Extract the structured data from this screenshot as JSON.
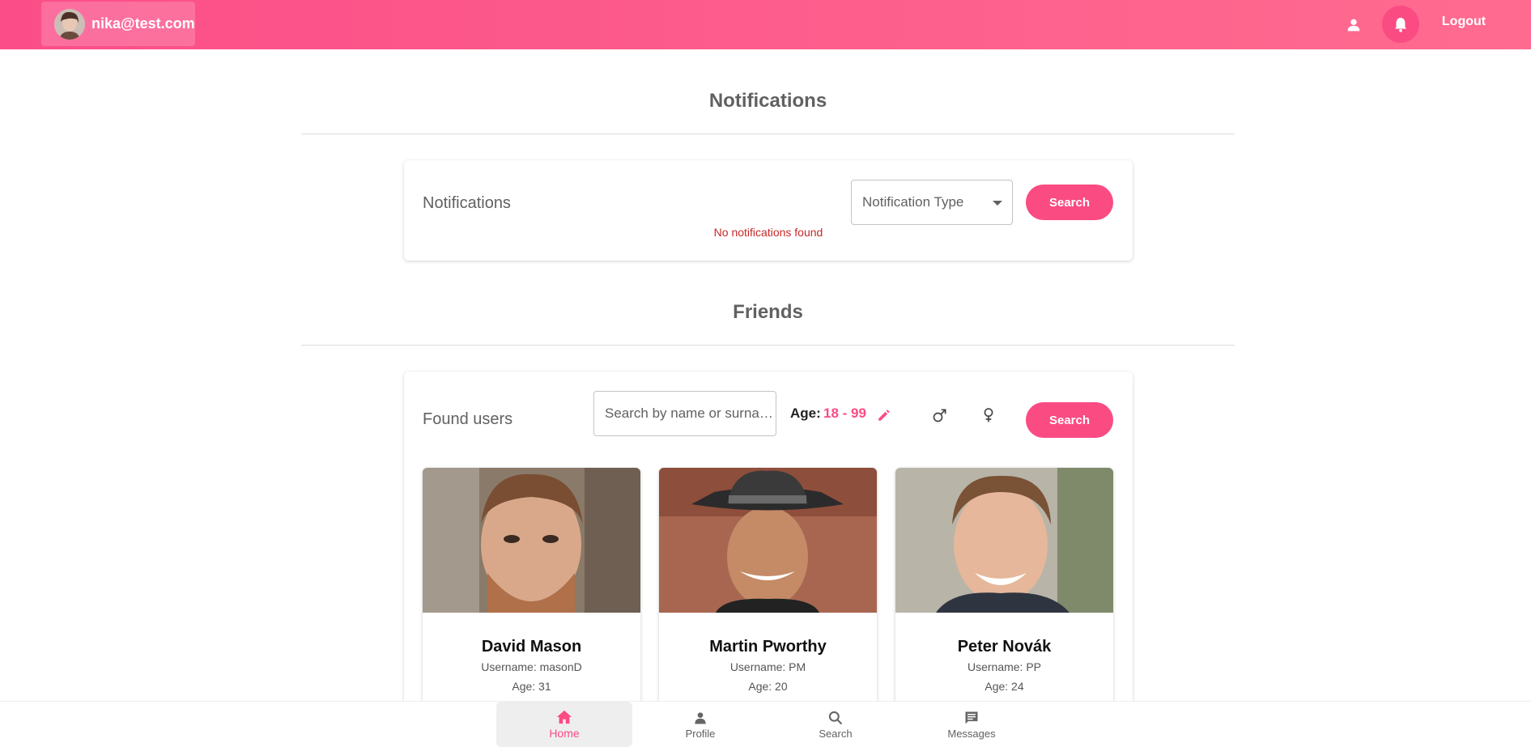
{
  "header": {
    "user_email": "nika@test.com",
    "logout_label": "Logout"
  },
  "notifications_section": {
    "title": "Notifications",
    "card_label": "Notifications",
    "type_select_value": "Notification Type",
    "search_button": "Search",
    "empty_message": "No notifications found"
  },
  "friends_section": {
    "title": "Friends",
    "card_label": "Found users",
    "search_placeholder": "Search by name or surna…",
    "age_label": "Age:",
    "age_value": "18 - 99",
    "search_button": "Search",
    "users": [
      {
        "name": "David Mason",
        "username": "Username: masonD",
        "age": "Age: 31"
      },
      {
        "name": "Martin Pworthy",
        "username": "Username: PM",
        "age": "Age: 20"
      },
      {
        "name": "Peter Novák",
        "username": "Username: PP",
        "age": "Age: 24"
      }
    ]
  },
  "bottom_nav": {
    "items": [
      {
        "label": "Home",
        "icon": "home-icon",
        "active": true
      },
      {
        "label": "Profile",
        "icon": "person-icon",
        "active": false
      },
      {
        "label": "Search",
        "icon": "search-icon",
        "active": false
      },
      {
        "label": "Messages",
        "icon": "message-icon",
        "active": false
      }
    ]
  },
  "colors": {
    "accent": "#fb4b83",
    "error": "#c62828"
  }
}
